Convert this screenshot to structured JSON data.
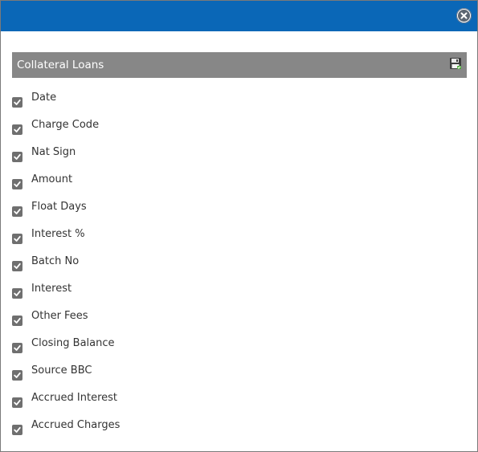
{
  "dialog": {
    "section_title": "Collateral Loans",
    "accent_color": "#0a67b7",
    "header_color": "#878787"
  },
  "icons": {
    "close": "close-icon",
    "save": "floppy-disk-icon",
    "check": "checkmark-icon"
  },
  "columns": [
    {
      "label": "Date",
      "checked": true
    },
    {
      "label": "Charge Code",
      "checked": true
    },
    {
      "label": "Nat Sign",
      "checked": true
    },
    {
      "label": "Amount",
      "checked": true
    },
    {
      "label": "Float Days",
      "checked": true
    },
    {
      "label": "Interest %",
      "checked": true
    },
    {
      "label": "Batch No",
      "checked": true
    },
    {
      "label": "Interest",
      "checked": true
    },
    {
      "label": "Other Fees",
      "checked": true
    },
    {
      "label": "Closing Balance",
      "checked": true
    },
    {
      "label": "Source BBC",
      "checked": true
    },
    {
      "label": "Accrued Interest",
      "checked": true
    },
    {
      "label": "Accrued Charges",
      "checked": true
    }
  ]
}
